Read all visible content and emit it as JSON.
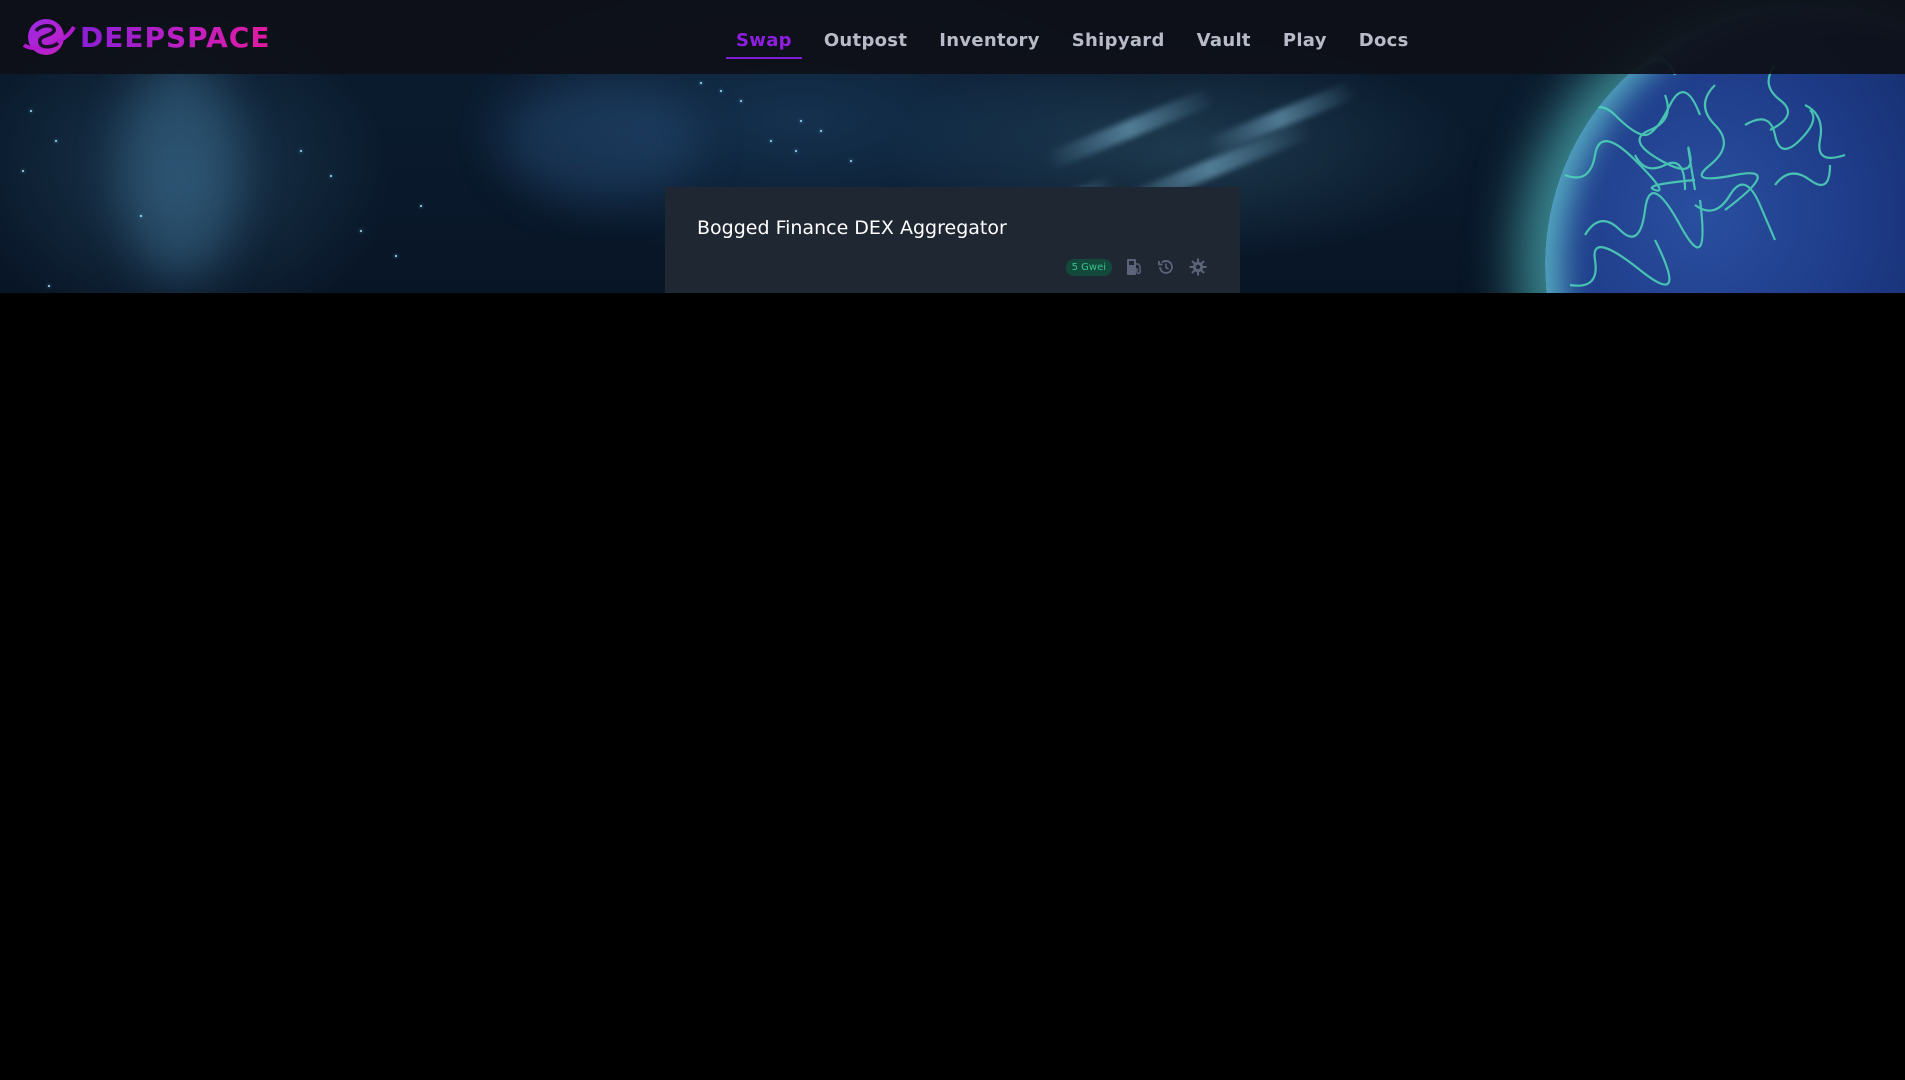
{
  "brand": {
    "name": "DEEPSPACE",
    "logo_icon": "deepspace-logo-icon"
  },
  "nav": {
    "items": [
      {
        "label": "Swap",
        "active": true
      },
      {
        "label": "Outpost",
        "active": false
      },
      {
        "label": "Inventory",
        "active": false
      },
      {
        "label": "Shipyard",
        "active": false
      },
      {
        "label": "Vault",
        "active": false
      },
      {
        "label": "Play",
        "active": false
      },
      {
        "label": "Docs",
        "active": false
      }
    ]
  },
  "swap_card": {
    "title": "Bogged Finance DEX Aggregator",
    "gas_badge": "5 Gwei",
    "icons": [
      "gas-pump-icon",
      "history-icon",
      "settings-gear-icon"
    ]
  },
  "colors": {
    "brand_gradient_start": "#8a1fd6",
    "brand_gradient_end": "#e01a9e",
    "nav_active": "#8f1fe0",
    "nav_text": "#b9bcc8",
    "card_bg": "#1f2733",
    "gas_badge_bg": "#12493a",
    "gas_badge_text": "#39c28b",
    "page_bg": "#000000"
  }
}
